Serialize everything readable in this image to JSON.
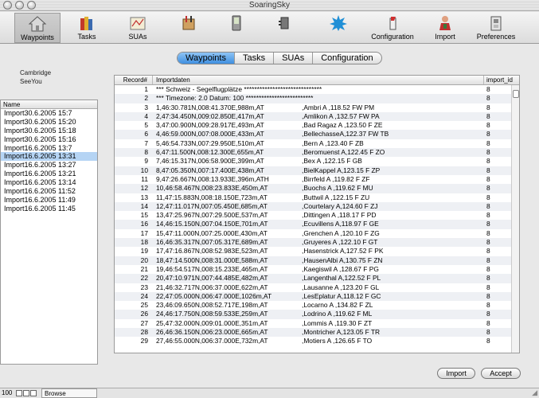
{
  "window": {
    "title": "SoaringSky"
  },
  "toolbar": {
    "items": [
      {
        "label": "Waypoints",
        "icon": "house-icon"
      },
      {
        "label": "Tasks",
        "icon": "books-icon"
      },
      {
        "label": "SUAs",
        "icon": "map-icon"
      },
      {
        "label": "",
        "icon": "tools-icon"
      },
      {
        "label": "",
        "icon": "pda-icon"
      },
      {
        "label": "",
        "icon": "plugin-icon"
      },
      {
        "label": "",
        "icon": "splash-icon"
      },
      {
        "label": "Configuration",
        "icon": "glider-icon"
      },
      {
        "label": "Import",
        "icon": "person-icon"
      },
      {
        "label": "Preferences",
        "icon": "switch-icon"
      }
    ]
  },
  "segments": [
    "Waypoints",
    "Tasks",
    "SUAs",
    "Configuration"
  ],
  "sources": [
    "Cambridge",
    "SeeYou"
  ],
  "imports": {
    "header": "Name",
    "items": [
      "Import30.6.2005 15:7",
      "Import30.6.2005 15:20",
      "Import30.6.2005 15:18",
      "Import30.6.2005 15:16",
      "Import16.6.2005 13:7",
      "Import16.6.2005 13:31",
      "Import16.6.2005 13:27",
      "Import16.6.2005 13:21",
      "Import16.6.2005 13:14",
      "Import16.6.2005 11:52",
      "Import16.6.2005 11:49",
      "Import16.6.2005 11:45"
    ]
  },
  "table": {
    "headers": [
      "Record#",
      "Importdaten",
      "import_id"
    ],
    "rows": [
      [
        "1",
        "*** Schweiz - Segelflugplätze ******************************",
        "",
        "8"
      ],
      [
        "2",
        "*** Timezone: 2.0  Datum: 100 **************************",
        "",
        "8"
      ],
      [
        "3",
        "1,46:30.781N,008:41.370E,988m,AT",
        ",Ambri A      ,118.52 FW PM",
        "8"
      ],
      [
        "4",
        "2,47:34.450N,009:02.850E,417m,AT",
        ",Amlikon A     ,132.57 FW PA",
        "8"
      ],
      [
        "5",
        "3,47:00.900N,009:28.917E,493m,AT",
        ",Bad Ragaz A  ,123.50 F  ZE",
        "8"
      ],
      [
        "6",
        "4,46:59.000N,007:08.000E,433m,AT",
        ",BellechasseA,122.37 FW TB",
        "8"
      ],
      [
        "7",
        "5,46:54.733N,007:29.950E,510m,AT",
        ",Bern A       ,123.40 F  ZB",
        "8"
      ],
      [
        "8",
        "6,47:11.500N,008:12.300E,655m,AT",
        ",Beromuenst A,122.45 F  ZO",
        "8"
      ],
      [
        "9",
        "7,46:15.317N,006:58.900E,399m,AT",
        ",Bex A        ,122.15 F  GB",
        "8"
      ],
      [
        "10",
        "8,47:05.350N,007:17.400E,438m,AT",
        ",BielKappel A,123.15 F  ZP",
        "8"
      ],
      [
        "11",
        "9,47:26.667N,008:13.933E,396m,ATH",
        ",Birrfeld A    ,119.82 F  ZF",
        "8"
      ],
      [
        "12",
        "10,46:58.467N,008:23.833E,450m,AT",
        ",Buochs A      ,119.62 F  MU",
        "8"
      ],
      [
        "13",
        "11,47:15.883N,008:18.150E,723m,AT",
        ",Buttwil A     ,122.15 F  ZU",
        "8"
      ],
      [
        "14",
        "12,47:11.017N,007:05.450E,685m,AT",
        ",Courtelary A,124.60 F  ZJ",
        "8"
      ],
      [
        "15",
        "13,47:25.967N,007:29.500E,537m,AT",
        ",Dittingen A   ,118.17 F  PD",
        "8"
      ],
      [
        "16",
        "14,46:15.150N,007:04.150E,701m,AT",
        ",Ecuvillens A,118.97 F  GE",
        "8"
      ],
      [
        "17",
        "15,47:11.000N,007:25.000E,430m,AT",
        ",Grenchen A   ,120.10 F  ZG",
        "8"
      ],
      [
        "18",
        "16,46:35.317N,007:05.317E,689m,AT",
        ",Gruyeres A    ,122.10 F  GT",
        "8"
      ],
      [
        "19",
        "17,47:16.867N,008:52.983E,523m,AT",
        ",Hasenstrick A,127.52 F  PK",
        "8"
      ],
      [
        "20",
        "18,47:14.500N,008:31.000E,588m,AT",
        ",HausenAlbi A,130.75 F  ZN",
        "8"
      ],
      [
        "21",
        "19,46:54.517N,008:15.233E,465m,AT",
        ",Kaegiswil A   ,128.67 F  PG",
        "8"
      ],
      [
        "22",
        "20,47:10.971N,007:44.485E,482m,AT",
        ",Langenthal A,122.52 F  PL",
        "8"
      ],
      [
        "23",
        "21,46:32.717N,006:37.000E,622m,AT",
        ",Lausanne A   ,123.20 F  GL",
        "8"
      ],
      [
        "24",
        "22,47:05.000N,006:47.000E,1026m,AT",
        ",LesEplatur A,118.12 F  GC",
        "8"
      ],
      [
        "25",
        "23,46:09.650N,008:52.717E,198m,AT",
        ",Locarno A     ,134.82 F  ZL",
        "8"
      ],
      [
        "26",
        "24,46:17.750N,008:59.533E,259m,AT",
        ",Lodrino A     ,119.62 F  ML",
        "8"
      ],
      [
        "27",
        "25,47:32.000N,009:01.000E,351m,AT",
        ",Lommis A      ,119.30 F  ZT",
        "8"
      ],
      [
        "28",
        "26,46:36.150N,006:23.000E,665m,AT",
        ",Montricher A,123.05 F  TR",
        "8"
      ],
      [
        "29",
        "27,46:55.000N,006:37.000E,732m,AT",
        ",Motiers A     ,126.65 F  TO",
        "8"
      ]
    ]
  },
  "buttons": {
    "import": "Import",
    "accept": "Accept"
  },
  "statusbar": {
    "zoom": "100",
    "mode": "Browse"
  }
}
